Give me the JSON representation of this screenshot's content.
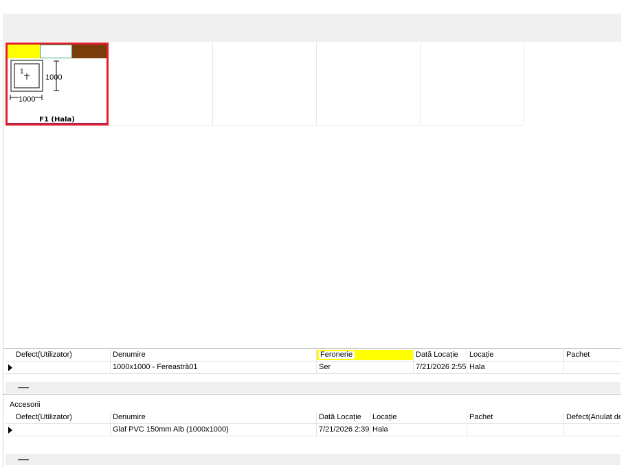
{
  "tile": {
    "title": "F1 (Hala)",
    "width_label": "1000",
    "height_label": "1000",
    "sash_label": "1",
    "colors": [
      "#ffff00",
      "#ffffff",
      "#7a3c0a"
    ]
  },
  "grid1": {
    "columns": [
      "Defect(Utilizator)",
      "Denumire",
      "Feronerie",
      "Dată Locație",
      "Locație",
      "Pachet"
    ],
    "rows": [
      [
        "",
        "1000x1000 - Fereastră01",
        "Ser",
        "7/21/2026 2:55",
        "Hala",
        ""
      ]
    ]
  },
  "grid2": {
    "section_label": "Accesorii",
    "columns": [
      "Defect(Utilizator)",
      "Denumire",
      "Dată Locație",
      "Locație",
      "Pachet",
      "Defect(Anulat de"
    ],
    "rows": [
      [
        "",
        "Glaf PVC 150mm Alb (1000x1000)",
        "7/21/2026 2:39",
        "Hala",
        "",
        ""
      ]
    ]
  },
  "colors": {
    "selection": "#e0202c",
    "highlight": "#ffff00"
  }
}
